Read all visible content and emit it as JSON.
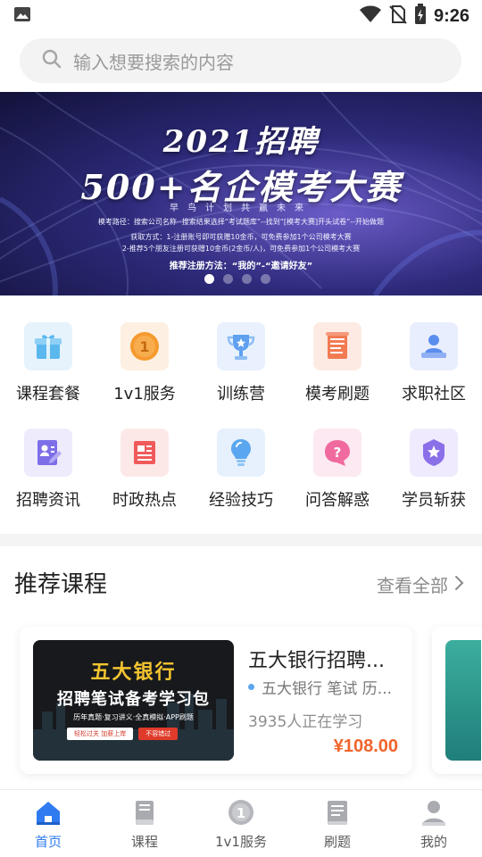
{
  "status_bar": {
    "time": "9:26",
    "icons": [
      "image-icon",
      "wifi-icon",
      "no-sim-icon",
      "battery-charging-icon"
    ]
  },
  "search": {
    "placeholder": "输入想要搜索的内容"
  },
  "banner": {
    "title_line1": "2021招聘",
    "title_line2": "500+名企模考大赛",
    "slogan": "早鸟计划共赢未来",
    "route": "模考路径：搜索公司名称--搜索结果选择“考试题库”--找到“[模考大赛]开头试卷”--开始做题",
    "get_method1": "获取方式：1-注册账号即可获赠10金币，可免费参加1个公司模考大赛",
    "get_method2": "2-推荐5个朋友注册可获赠10金币(2金币/人)，可免费参加1个公司模考大赛",
    "invite": "推荐注册方法：“我的”-“邀请好友”",
    "slide_count": 4,
    "active_slide": 0
  },
  "grid": {
    "items": [
      {
        "label": "课程套餐",
        "icon": "gift-icon",
        "color": "#5bb8ef"
      },
      {
        "label": "1v1服务",
        "icon": "one-coin-icon",
        "color": "#f59a2f"
      },
      {
        "label": "训练营",
        "icon": "trophy-icon",
        "color": "#5fa0ef"
      },
      {
        "label": "模考刷题",
        "icon": "scroll-icon",
        "color": "#f37b52"
      },
      {
        "label": "求职社区",
        "icon": "person-desk-icon",
        "color": "#5b8def"
      },
      {
        "label": "招聘资讯",
        "icon": "resume-icon",
        "color": "#7d6ee8"
      },
      {
        "label": "时政热点",
        "icon": "newspaper-icon",
        "color": "#f05a5a"
      },
      {
        "label": "经验技巧",
        "icon": "lightbulb-icon",
        "color": "#5aa7f0"
      },
      {
        "label": "问答解惑",
        "icon": "question-bubble-icon",
        "color": "#f06aa0"
      },
      {
        "label": "学员斩获",
        "icon": "badge-icon",
        "color": "#8a6fe8"
      }
    ]
  },
  "section": {
    "title": "推荐课程",
    "more_label": "查看全部"
  },
  "course": {
    "name": "五大银行招聘...",
    "tags": "五大银行 笔试 历...",
    "learners": "3935人正在学习",
    "price": "¥108.00",
    "thumb_title1": "五大银行",
    "thumb_title2": "招聘笔试备考学习包",
    "thumb_sub": "历年真题·复习讲义·全真模拟·APP刷题",
    "thumb_btn1": "轻松过关 加薪上岸",
    "thumb_btn2": "不容错过"
  },
  "bottom_nav": {
    "active": 0,
    "items": [
      {
        "label": "首页",
        "icon": "home-icon"
      },
      {
        "label": "课程",
        "icon": "book-icon"
      },
      {
        "label": "1v1服务",
        "icon": "one-coin-icon"
      },
      {
        "label": "刷题",
        "icon": "document-icon"
      },
      {
        "label": "我的",
        "icon": "person-icon"
      }
    ]
  },
  "colors": {
    "accent": "#2f7bef",
    "price": "#f0642b",
    "thumb_gold": "#f5c530"
  }
}
